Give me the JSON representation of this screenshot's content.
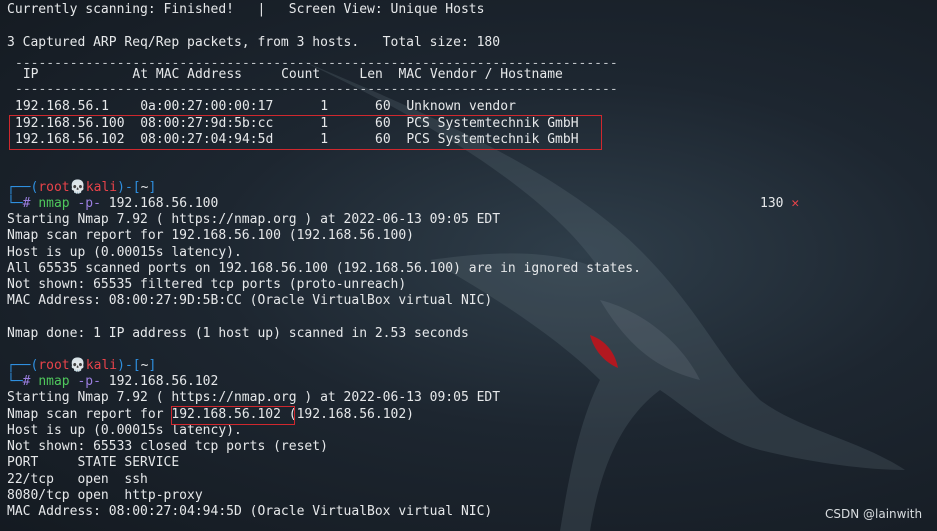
{
  "status_line": "Currently scanning: Finished!   |   Screen View: Unique Hosts",
  "summary_line": "3 Captured ARP Req/Rep packets, from 3 hosts.   Total size: 180",
  "table_rule": "-----------------------------------------------------------------------------",
  "table_header": " IP            At MAC Address     Count     Len  MAC Vendor / Hostname",
  "table_rows": [
    "192.168.56.1    0a:00:27:00:00:17      1      60  Unknown vendor",
    "192.168.56.100  08:00:27:9d:5b:cc      1      60  PCS Systemtechnik GmbH",
    "192.168.56.102  08:00:27:04:94:5d      1      60  PCS Systemtechnik GmbH"
  ],
  "prompt": {
    "corner_top": "┌──",
    "open": "(",
    "user": "root",
    "skull": "💀",
    "host": "kali",
    "close": ")-[",
    "dir": "~",
    "end": "]",
    "corner_bottom": "└─",
    "hash": "#"
  },
  "command1": {
    "bin": "nmap",
    "flag": "-p-",
    "target": "192.168.56.100"
  },
  "exit_code": {
    "value": "130",
    "symbol": "✕"
  },
  "scan1": [
    "Starting Nmap 7.92 ( https://nmap.org ) at 2022-06-13 09:05 EDT",
    "Nmap scan report for 192.168.56.100 (192.168.56.100)",
    "Host is up (0.00015s latency).",
    "All 65535 scanned ports on 192.168.56.100 (192.168.56.100) are in ignored states.",
    "Not shown: 65535 filtered tcp ports (proto-unreach)",
    "MAC Address: 08:00:27:9D:5B:CC (Oracle VirtualBox virtual NIC)"
  ],
  "done1": "Nmap done: 1 IP address (1 host up) scanned in 2.53 seconds",
  "command2": {
    "bin": "nmap",
    "flag": "-p-",
    "target": "192.168.56.102"
  },
  "scan2": {
    "start": "Starting Nmap 7.92 ( https://nmap.org ) at 2022-06-13 09:05 EDT",
    "report_prefix": "Nmap scan report for ",
    "report_ip": "192.168.56.102",
    "report_suffix": " (192.168.56.102)",
    "lines": [
      "Host is up (0.00015s latency).",
      "Not shown: 65533 closed tcp ports (reset)",
      "PORT     STATE SERVICE",
      "22/tcp   open  ssh",
      "8080/tcp open  http-proxy",
      "MAC Address: 08:00:27:04:94:5D (Oracle VirtualBox virtual NIC)"
    ]
  },
  "watermark": "CSDN @lainwith",
  "colors": {
    "prompt_blue": "#2f8fdf",
    "prompt_red": "#e8434a",
    "command_green": "#4fc85c",
    "flag_purple": "#9b7ee0",
    "highlight_box": "#d0282e"
  }
}
